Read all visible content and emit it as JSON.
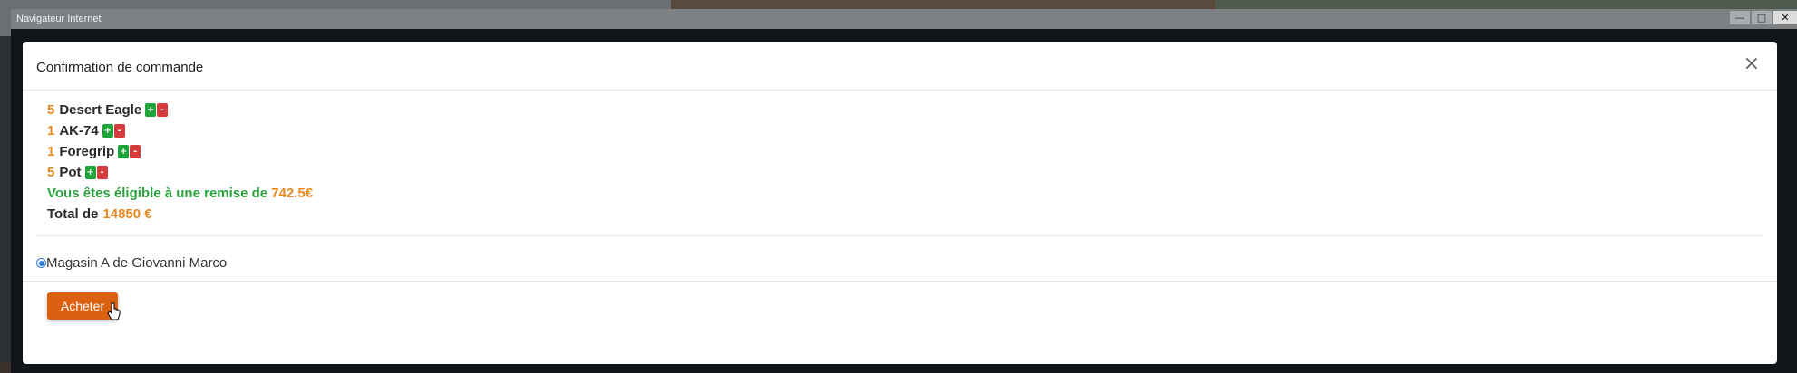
{
  "window": {
    "title": "Navigateur Internet",
    "controls": {
      "minimize": "—",
      "maximize": "□",
      "close": "✕"
    }
  },
  "modal": {
    "title": "Confirmation de commande",
    "close_icon": "×",
    "items": [
      {
        "qty": "5",
        "name": "Desert Eagle",
        "plus": "+",
        "minus": "-"
      },
      {
        "qty": "1",
        "name": "AK-74",
        "plus": "+",
        "minus": "-"
      },
      {
        "qty": "1",
        "name": "Foregrip",
        "plus": "+",
        "minus": "-"
      },
      {
        "qty": "5",
        "name": "Pot",
        "plus": "+",
        "minus": "-"
      }
    ],
    "discount_text": "Vous êtes éligible à une remise de",
    "discount_amount": "742.5€",
    "total_label": "Total de",
    "total_value": "14850 €",
    "shop_option": {
      "label": "Magasin A de Giovanni Marco",
      "selected": true
    },
    "buy_label": "Acheter"
  },
  "colors": {
    "accent_orange": "#e8891f",
    "button_orange": "#db6111",
    "plus_green": "#1fa43a",
    "minus_red": "#d73c3c",
    "discount_green": "#2aa33e",
    "radio_blue": "#2f7bd8"
  }
}
